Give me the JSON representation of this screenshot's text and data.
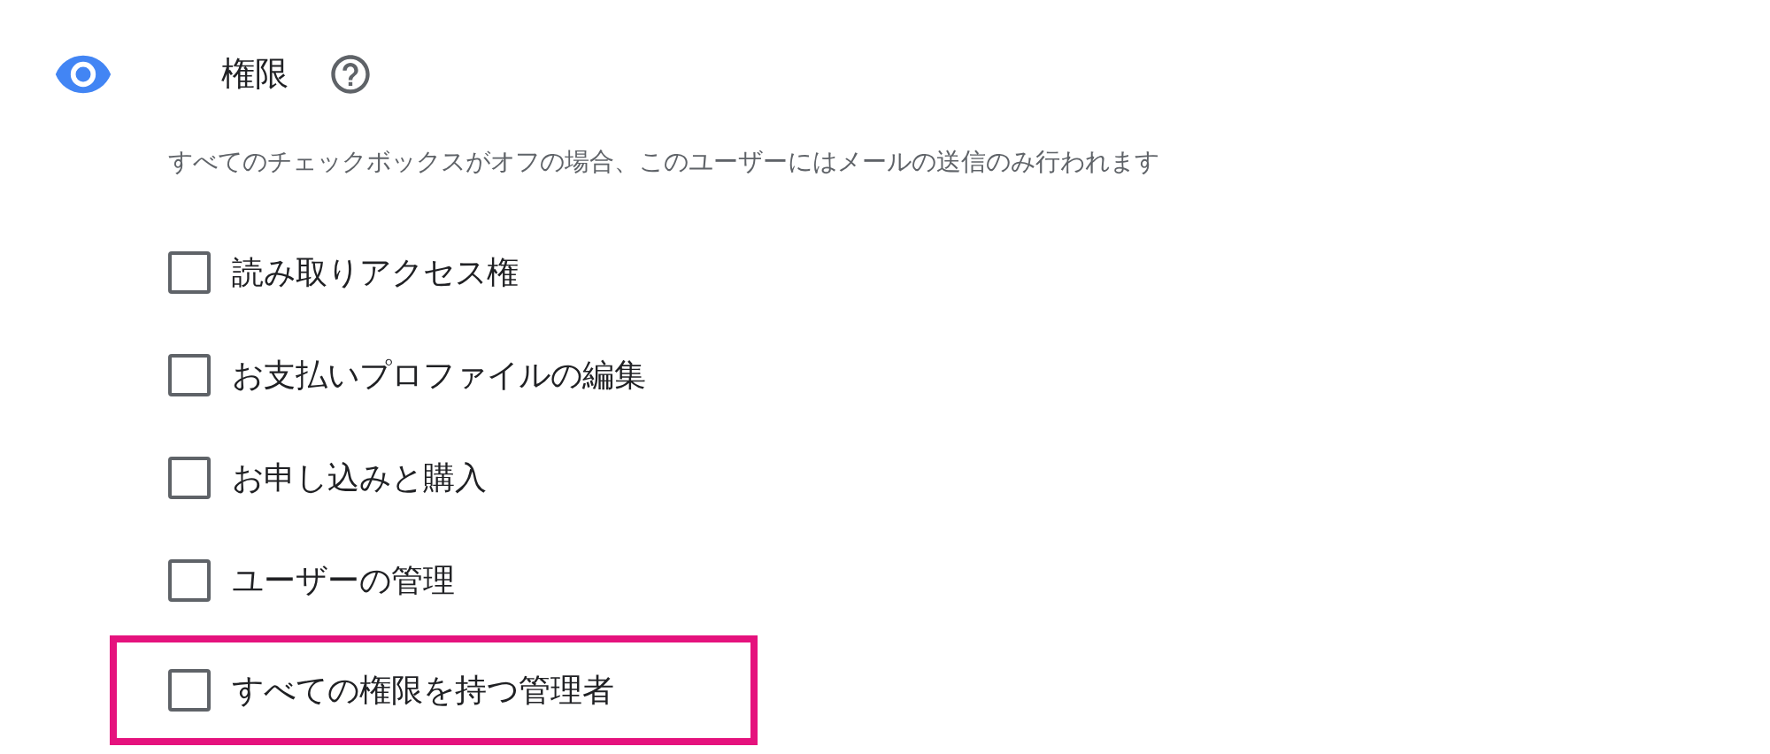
{
  "section": {
    "title": "権限",
    "description": "すべてのチェックボックスがオフの場合、このユーザーにはメールの送信のみ行われます"
  },
  "permissions": [
    {
      "label": "読み取りアクセス権",
      "checked": false,
      "highlighted": false
    },
    {
      "label": "お支払いプロファイルの編集",
      "checked": false,
      "highlighted": false
    },
    {
      "label": "お申し込みと購入",
      "checked": false,
      "highlighted": false
    },
    {
      "label": "ユーザーの管理",
      "checked": false,
      "highlighted": false
    },
    {
      "label": "すべての権限を持つ管理者",
      "checked": false,
      "highlighted": true
    }
  ]
}
